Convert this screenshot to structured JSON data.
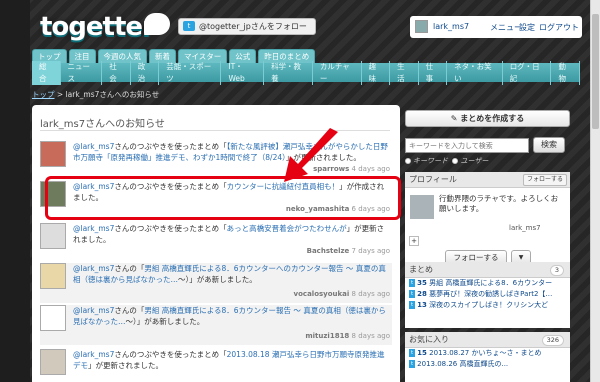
{
  "header": {
    "logo": "togetter",
    "follow_button": "@togetter_jpさんをフォロー",
    "user": "lark_ms7",
    "menu": "メニュー",
    "settings": "設定",
    "logout": "ログアウト"
  },
  "top_tabs": [
    "トップ",
    "注目",
    "今週の人気",
    "新着",
    "マイスター",
    "公式",
    "昨日のまとめ"
  ],
  "nav": [
    "総合",
    "ニュース",
    "社会",
    "政治",
    "芸能・スポーツ",
    "IT・Web",
    "科学・教養",
    "カルチャー",
    "趣味",
    "生活",
    "仕事",
    "ネタ・お笑い",
    "ログ・日記",
    "動物"
  ],
  "nav_active": "総合",
  "breadcrumb": {
    "home": "トップ",
    "sep": " > ",
    "current": "lark_ms7さんへのお知らせ"
  },
  "main": {
    "title": "lark_ms7さんへのお知らせ",
    "items": [
      {
        "user": "@lark_ms7",
        "pre": "さんのつぶやきを使ったまとめ「",
        "link": "【新たな風評被】瀬戸弘幸さんがやらかした日野市万願寺「原発再稼働」推進デモ、わずか1時間で終了（8/24）",
        "post": "」が更新されました。",
        "author": "sparrows",
        "time": "4 days ago"
      },
      {
        "user": "@lark_ms7",
        "pre": "さんのつぶやきを使ったまとめ「",
        "link": "カウンターに抗議紐付直員相も！",
        "post": "」が作成されました。",
        "author": "neko_yamashita",
        "time": "6 days ago"
      },
      {
        "user": "@lark_ms7",
        "pre": "さんのつぶやきを使ったまとめ「",
        "link": "あっと高橋安晋着会がつたわせんが",
        "post": "」が更新されました。",
        "author": "Bachstelze",
        "time": "7 days ago"
      },
      {
        "user": "@lark_ms7",
        "pre": "さんの「",
        "link": "男組 高橋直輝氏による8．6カウンターへのカウンター報告 〜 真夏の真相（徳は裏から見ばなかった…",
        "post": "〜）」があ新しました。",
        "author": "vocalosyoukai",
        "time": "8 days ago"
      },
      {
        "user": "@lark_ms7",
        "pre": "さんの「",
        "link": "男組 高橋直輝氏による8．6カウンター報告 〜 真夏の真相（徳は裏から見ばなかった…",
        "post": "〜）」があ新しました。",
        "author": "mituzi1818",
        "time": "8 days ago"
      },
      {
        "user": "@lark_ms7",
        "pre": "さんのつぶやきを使ったまとめ「",
        "link": "2013.08.18 瀬戸弘幸ら日野市万願寺原発推進デモ",
        "post": "」が更新されました。",
        "author": "",
        "time": ""
      }
    ]
  },
  "side": {
    "create_button": "まとめを作成する",
    "search_placeholder": "キーワードを入力して検索",
    "search_button": "検索",
    "radio1": "キーワード",
    "radio2": "ユーザー",
    "profile_head": "プロフィール",
    "profile_follow_tw": "フォローする",
    "profile_bio": "行動界隈のラチャです。よろしくお願いします。",
    "profile_name": "lark_ms7",
    "follow_button": "フォローする",
    "follow_dropdown": "▼",
    "matome_head": "まとめ",
    "matome_count": "3",
    "matome_items": [
      {
        "n": "35",
        "t": "男組 高橋直輝氏による8．6カウンター"
      },
      {
        "n": "28",
        "t": "悪夢再び！深夜の勧誘しばきPart2【…"
      },
      {
        "n": "13",
        "t": "深夜のスカイプしばき！クリシン大ど"
      }
    ],
    "fav_head": "お気に入り",
    "fav_count": "326",
    "fav_items": [
      {
        "n": "15",
        "t": "2013.08.27 かいちょ〜さ・まとめ"
      },
      {
        "n": "",
        "t": "2013.08.26 高橋直輝氏の..."
      }
    ]
  },
  "chart_data": null
}
